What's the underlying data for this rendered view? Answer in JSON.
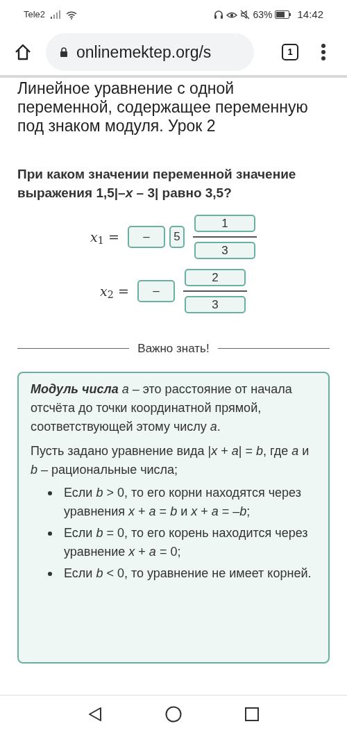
{
  "status_bar": {
    "carrier": "Tele2",
    "battery": "63%",
    "time": "14:42"
  },
  "browser": {
    "url": "onlinemektep.org/s",
    "tab_count": "1"
  },
  "lesson_title": "Линейное уравнение с одной переменной, содержащее переменную под знаком модуля. Урок 2",
  "question": "При каком значении переменной значение выражения 1,5|–*x* – 3| равно 3,5?",
  "answers": [
    {
      "label": "*x*$_{1}$ =",
      "sign": "–",
      "whole": "5",
      "numerator": "1",
      "denominator": "3"
    },
    {
      "label": "*x*$_{2}$ =",
      "sign": "–",
      "numerator": "2",
      "denominator": "3"
    }
  ],
  "divider_label": "Важно знать!",
  "info_card": {
    "paragraphs": [
      "**Модуль числа** *a* – это расстояние от начала отсчёта до точки координатной прямой, соответствующей этому числу *a*.",
      "Пусть задано уравнение вида |*x* + *a*| = *b*, где *a* и *b* – рациональные числа;"
    ],
    "bullets": [
      "Если *b* > 0, то его корни находятся через уравнения *x* + *a* = *b* и *x* + *a* = –*b*;",
      "Если *b* = 0, то его корень находится через уравнение *x* + *a* = 0;",
      "Если *b* < 0, то уравнение не имеет корней."
    ]
  }
}
